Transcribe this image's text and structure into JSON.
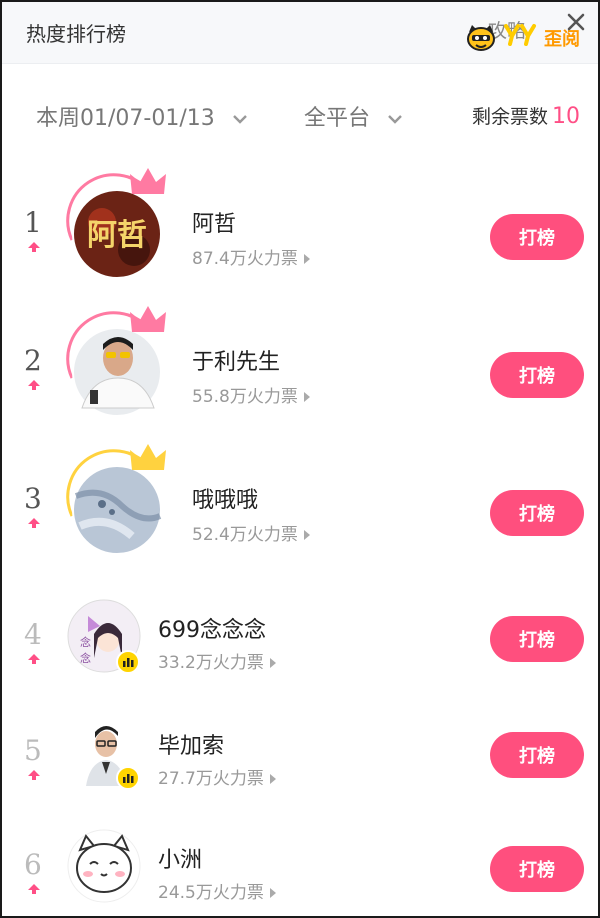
{
  "header": {
    "title": "热度排行榜",
    "gonglue": "攻略",
    "brand_logo_text": "歪阅",
    "close_icon": "close-icon"
  },
  "filters": {
    "week_label": "本周01/07-01/13",
    "platform_label": "全平台",
    "votes_label": "剩余票数",
    "votes_count": "10"
  },
  "colors": {
    "accent": "#ff4f86",
    "button": "#ff4f7e",
    "crown_pink": "#ff7aa2",
    "crown_gold": "#ffd23f"
  },
  "ranking": [
    {
      "rank": "1",
      "name": "阿哲",
      "fire": "87.4万火力票",
      "button": "打榜",
      "trend": "up",
      "crown": "pink"
    },
    {
      "rank": "2",
      "name": "于利先生",
      "fire": "55.8万火力票",
      "button": "打榜",
      "trend": "up",
      "crown": "pink"
    },
    {
      "rank": "3",
      "name": "哦哦哦",
      "fire": "52.4万火力票",
      "button": "打榜",
      "trend": "up",
      "crown": "gold"
    },
    {
      "rank": "4",
      "name": "699念念念",
      "fire": "33.2万火力票",
      "button": "打榜",
      "trend": "up",
      "badge": "live-badge-icon"
    },
    {
      "rank": "5",
      "name": "毕加索",
      "fire": "27.7万火力票",
      "button": "打榜",
      "trend": "up",
      "badge": "live-badge-icon"
    },
    {
      "rank": "6",
      "name": "小洲",
      "fire": "24.5万火力票",
      "button": "打榜",
      "trend": "up"
    }
  ]
}
